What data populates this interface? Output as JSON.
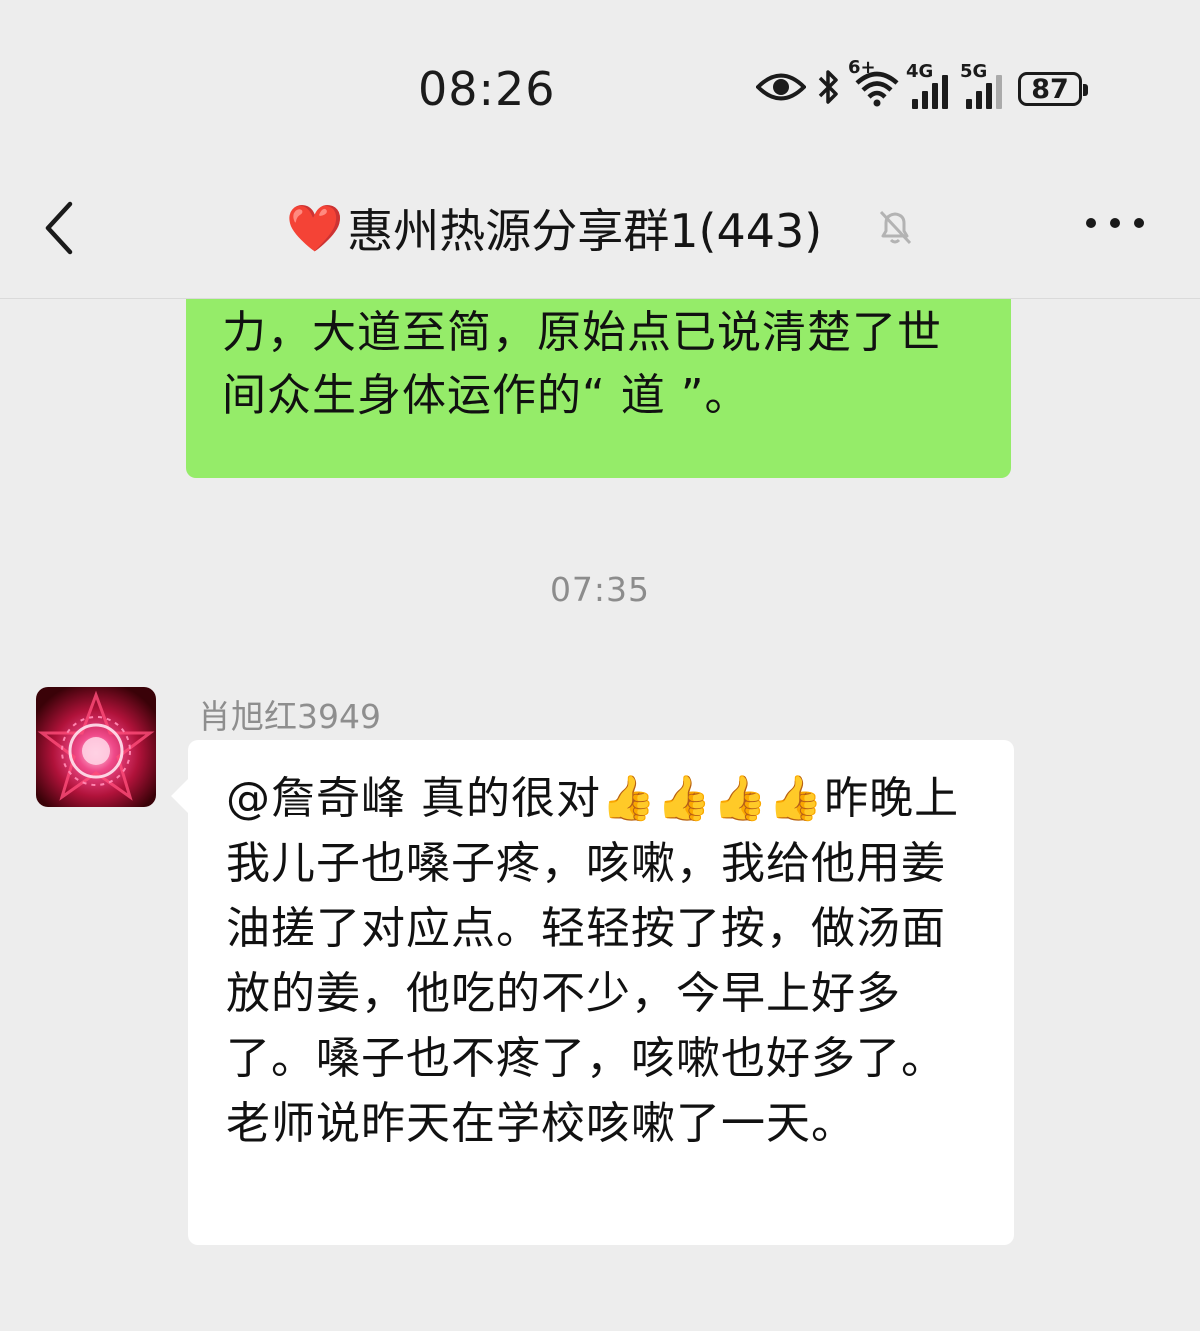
{
  "status_bar": {
    "time": "08:26",
    "wifi_badge": "6+",
    "signal1": "4G",
    "signal2": "5G",
    "battery": "87",
    "icons": [
      "eye-icon",
      "bluetooth-icon",
      "wifi-icon",
      "signal-4g-icon",
      "signal-5g-icon",
      "battery-icon"
    ]
  },
  "header": {
    "heart": "❤️",
    "title": "惠州热源分享群1(443)",
    "icons": [
      "back-icon",
      "mute-bell-icon",
      "more-icon"
    ]
  },
  "messages": [
    {
      "type": "outgoing",
      "text": "源等，都能提升体力与免疫力、自愈力，大道至简，原始点已说清楚了世间众生身体运作的“ 道 ”。"
    },
    {
      "type": "timestamp",
      "text": "07:35"
    },
    {
      "type": "incoming",
      "sender": "肖旭红3949",
      "text": "@詹奇峰  真的很对👍👍👍👍昨晚上我儿子也嗓子疼，咳嗽，我给他用姜油搓了对应点。轻轻按了按，做汤面放的姜，他吃的不少，今早上好多了。嗓子也不疼了，咳嗽也好多了。老师说昨天在学校咳嗽了一天。"
    }
  ],
  "colors": {
    "background": "#ededed",
    "outgoing_bubble": "#95ec69",
    "incoming_bubble": "#ffffff",
    "meta_text": "#8c8c8c"
  }
}
